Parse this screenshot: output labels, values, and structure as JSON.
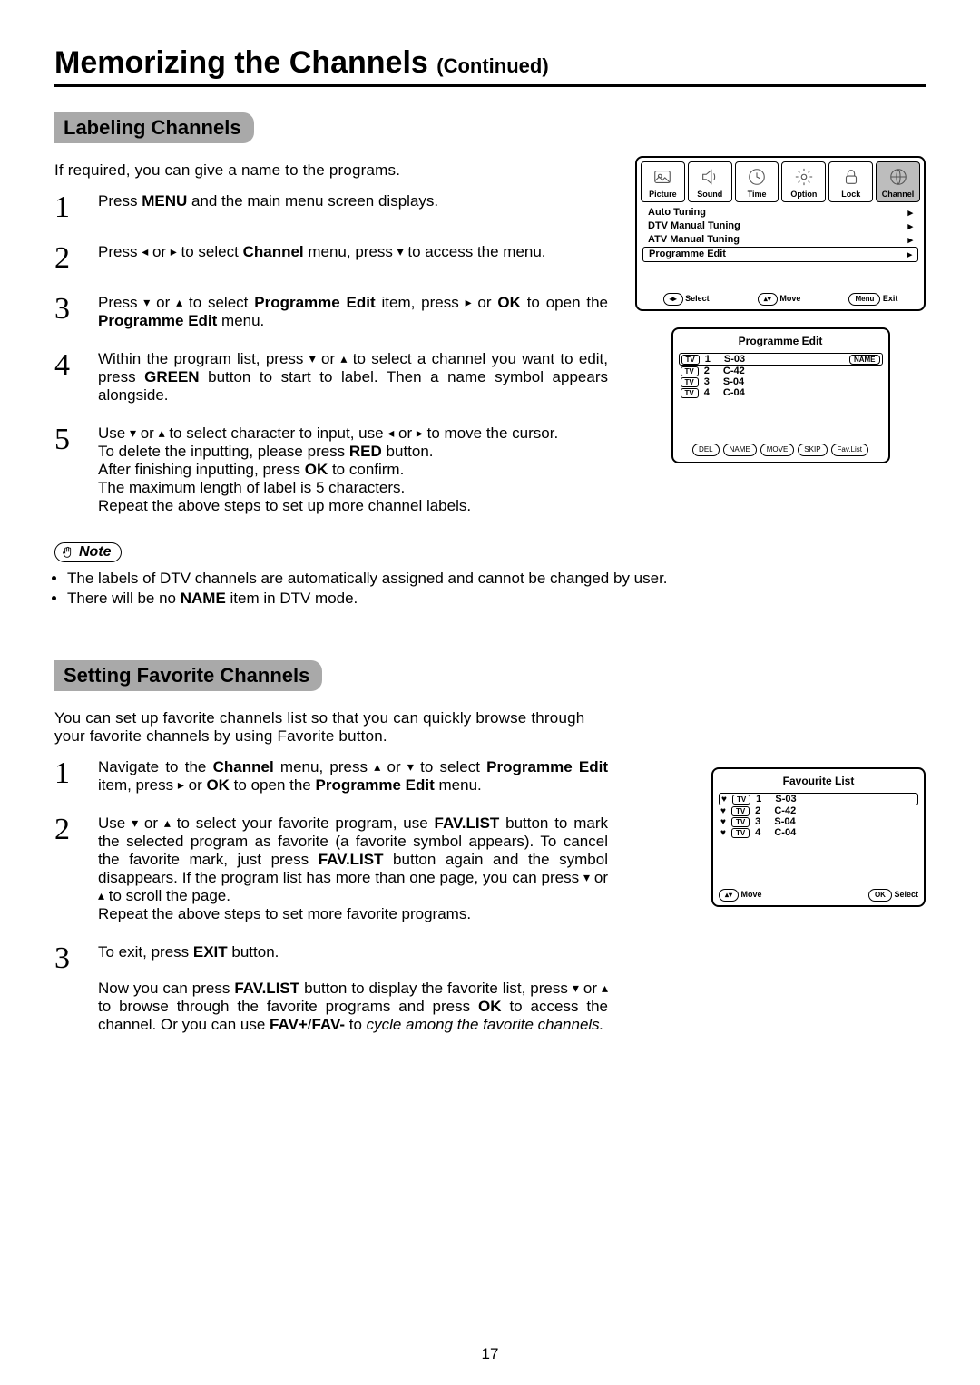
{
  "page_number": "17",
  "title_main": "Memorizing the Channels ",
  "title_cont": "(Continued)",
  "sectionA": {
    "heading": "Labeling Channels",
    "intro": "If required, you can give a name to the programs.",
    "steps": {
      "s1a": "Press ",
      "s1b": "MENU",
      "s1c": " and the main menu screen displays.",
      "s2a": "Press ",
      "s2b": " or ",
      "s2c": " to select ",
      "s2d": "Channel",
      "s2e": " menu,  press ",
      "s2f": " to access the menu.",
      "s3a": "Press ",
      "s3b": " or ",
      "s3c": " to select ",
      "s3d": "Programme Edit",
      "s3e": " item, press ",
      "s3f": " or ",
      "s3g": "OK",
      "s3h": " to open the ",
      "s3i": "Programme Edit",
      "s3j": " menu.",
      "s4a": "Within the program list,  press ",
      "s4b": " or ",
      "s4c": " to select a channel you want to edit, press ",
      "s4d": "GREEN",
      "s4e": " button to start to label. Then a name symbol appears alongside.",
      "s5a": "Use ",
      "s5b": " or ",
      "s5c": " to select character to input, use ",
      "s5d": " or ",
      "s5e": " to move the cursor.",
      "s5f": "To delete the inputting, please press ",
      "s5g": "RED",
      "s5h": " button.",
      "s5i": "After finishing inputting, press ",
      "s5j": "OK",
      "s5k": " to confirm.",
      "s5l": "The maximum length of label is 5 characters.",
      "s5m": "Repeat the above steps to set up more channel labels."
    },
    "note_label": "Note",
    "notes": {
      "n1": "The labels of DTV channels are automatically assigned and cannot be changed by user.",
      "n2a": "There will be no ",
      "n2b": "NAME",
      "n2c": " item in DTV mode."
    }
  },
  "sectionB": {
    "heading": "Setting Favorite Channels",
    "intro": "You can set up favorite channels list so that you can quickly browse through your favorite channels by using Favorite button.",
    "steps": {
      "s1a": "Navigate to the ",
      "s1b": "Channel",
      "s1c": " menu,  press ",
      "s1d": " or ",
      "s1e": " to select ",
      "s1f": "Programme Edit",
      "s1g": " item, press ",
      "s1h": " or ",
      "s1i": "OK",
      "s1j": " to open the ",
      "s1k": "Programme Edit",
      "s1l": " menu.",
      "s2a": "Use ",
      "s2b": " or ",
      "s2c": " to select your favorite program, use ",
      "s2d": "FAV.LIST",
      "s2e": " button to mark the selected program as favorite (a favorite symbol appears).  To cancel the favorite mark, just press ",
      "s2f": "FAV.LIST",
      "s2g": " button again and the symbol disappears. If the program list has more than one page, you can press ",
      "s2h": " or ",
      "s2i": " to scroll the page.",
      "s2j": "Repeat the above steps to set more favorite programs.",
      "s3a": "To exit, press ",
      "s3b": "EXIT",
      "s3c": " button.",
      "s3d": "Now you can press ",
      "s3e": "FAV.LIST",
      "s3f": " button to display the favorite list, press ",
      "s3g": " or ",
      "s3h": " to browse through the favorite programs and press ",
      "s3i": "OK",
      "s3j": " to access the channel. Or you can use ",
      "s3k": "FAV+",
      "s3l": "/",
      "s3m": "FAV-",
      "s3n": " to ",
      "s3o": "cycle among the favorite channels."
    }
  },
  "osd": {
    "tabs": [
      "Picture",
      "Sound",
      "Time",
      "Option",
      "Lock",
      "Channel"
    ],
    "menu": {
      "r1": "Auto Tuning",
      "r2": "DTV Manual Tuning",
      "r3": "ATV Manual Tuning",
      "r4": "Programme Edit"
    },
    "foot": {
      "select": "Select",
      "move": "Move",
      "menu": "Menu",
      "exit": "Exit"
    }
  },
  "progedit": {
    "title": "Programme Edit",
    "rows": [
      {
        "n": "1",
        "ch": "S-03"
      },
      {
        "n": "2",
        "ch": "C-42"
      },
      {
        "n": "3",
        "ch": "S-04"
      },
      {
        "n": "4",
        "ch": "C-04"
      }
    ],
    "name": "NAME",
    "foot": [
      "DEL",
      "NAME",
      "MOVE",
      "SKIP",
      "Fav.List"
    ]
  },
  "fav": {
    "title": "Favourite List",
    "rows": [
      {
        "n": "1",
        "ch": "S-03"
      },
      {
        "n": "2",
        "ch": "C-42"
      },
      {
        "n": "3",
        "ch": "S-04"
      },
      {
        "n": "4",
        "ch": "C-04"
      }
    ],
    "foot": {
      "move": "Move",
      "ok": "OK",
      "select": "Select"
    }
  },
  "glyph": {
    "left": "◂",
    "right": "▸",
    "up": "▴",
    "down": "▾",
    "rarrow": "▸"
  }
}
